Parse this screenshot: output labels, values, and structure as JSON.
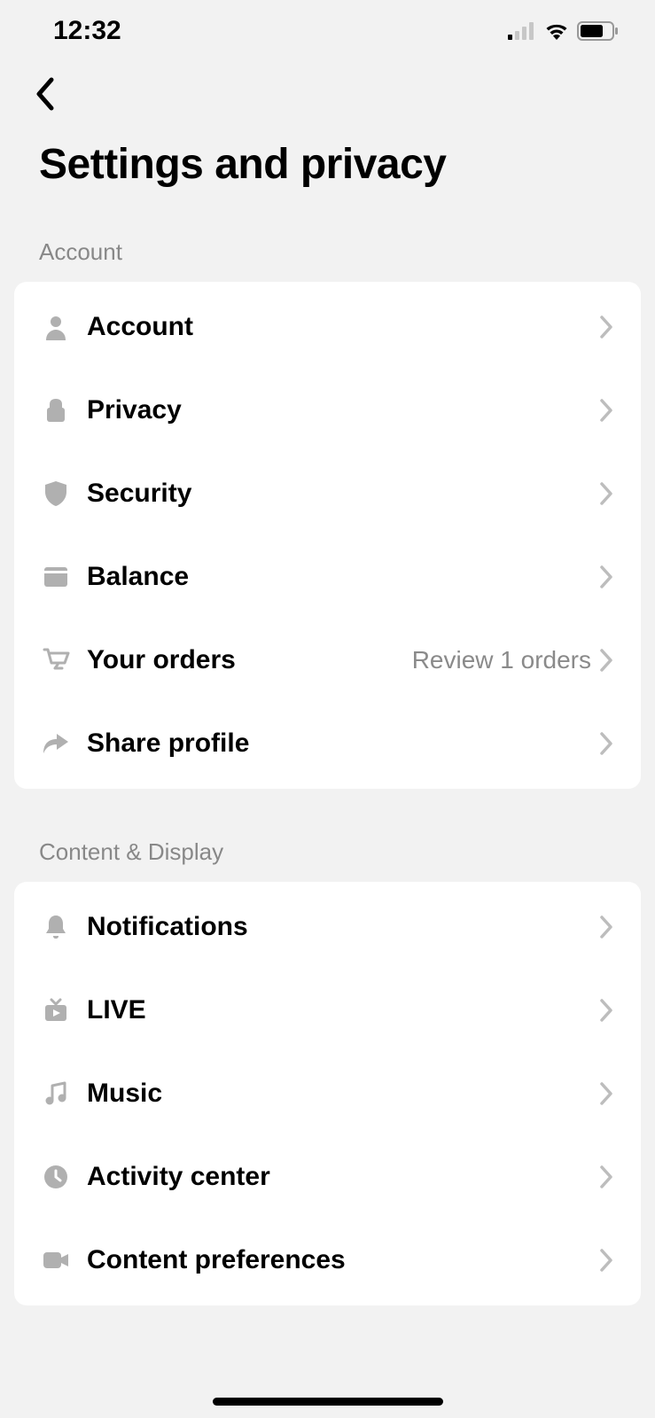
{
  "status": {
    "time": "12:32"
  },
  "page_title": "Settings and privacy",
  "sections": {
    "account": {
      "header": "Account",
      "items": {
        "account": {
          "label": "Account"
        },
        "privacy": {
          "label": "Privacy"
        },
        "security": {
          "label": "Security"
        },
        "balance": {
          "label": "Balance"
        },
        "your_orders": {
          "label": "Your orders",
          "detail": "Review 1 orders"
        },
        "share_profile": {
          "label": "Share profile"
        }
      }
    },
    "content_display": {
      "header": "Content & Display",
      "items": {
        "notifications": {
          "label": "Notifications"
        },
        "live": {
          "label": "LIVE"
        },
        "music": {
          "label": "Music"
        },
        "activity_center": {
          "label": "Activity center"
        },
        "content_preferences": {
          "label": "Content preferences"
        }
      }
    }
  }
}
